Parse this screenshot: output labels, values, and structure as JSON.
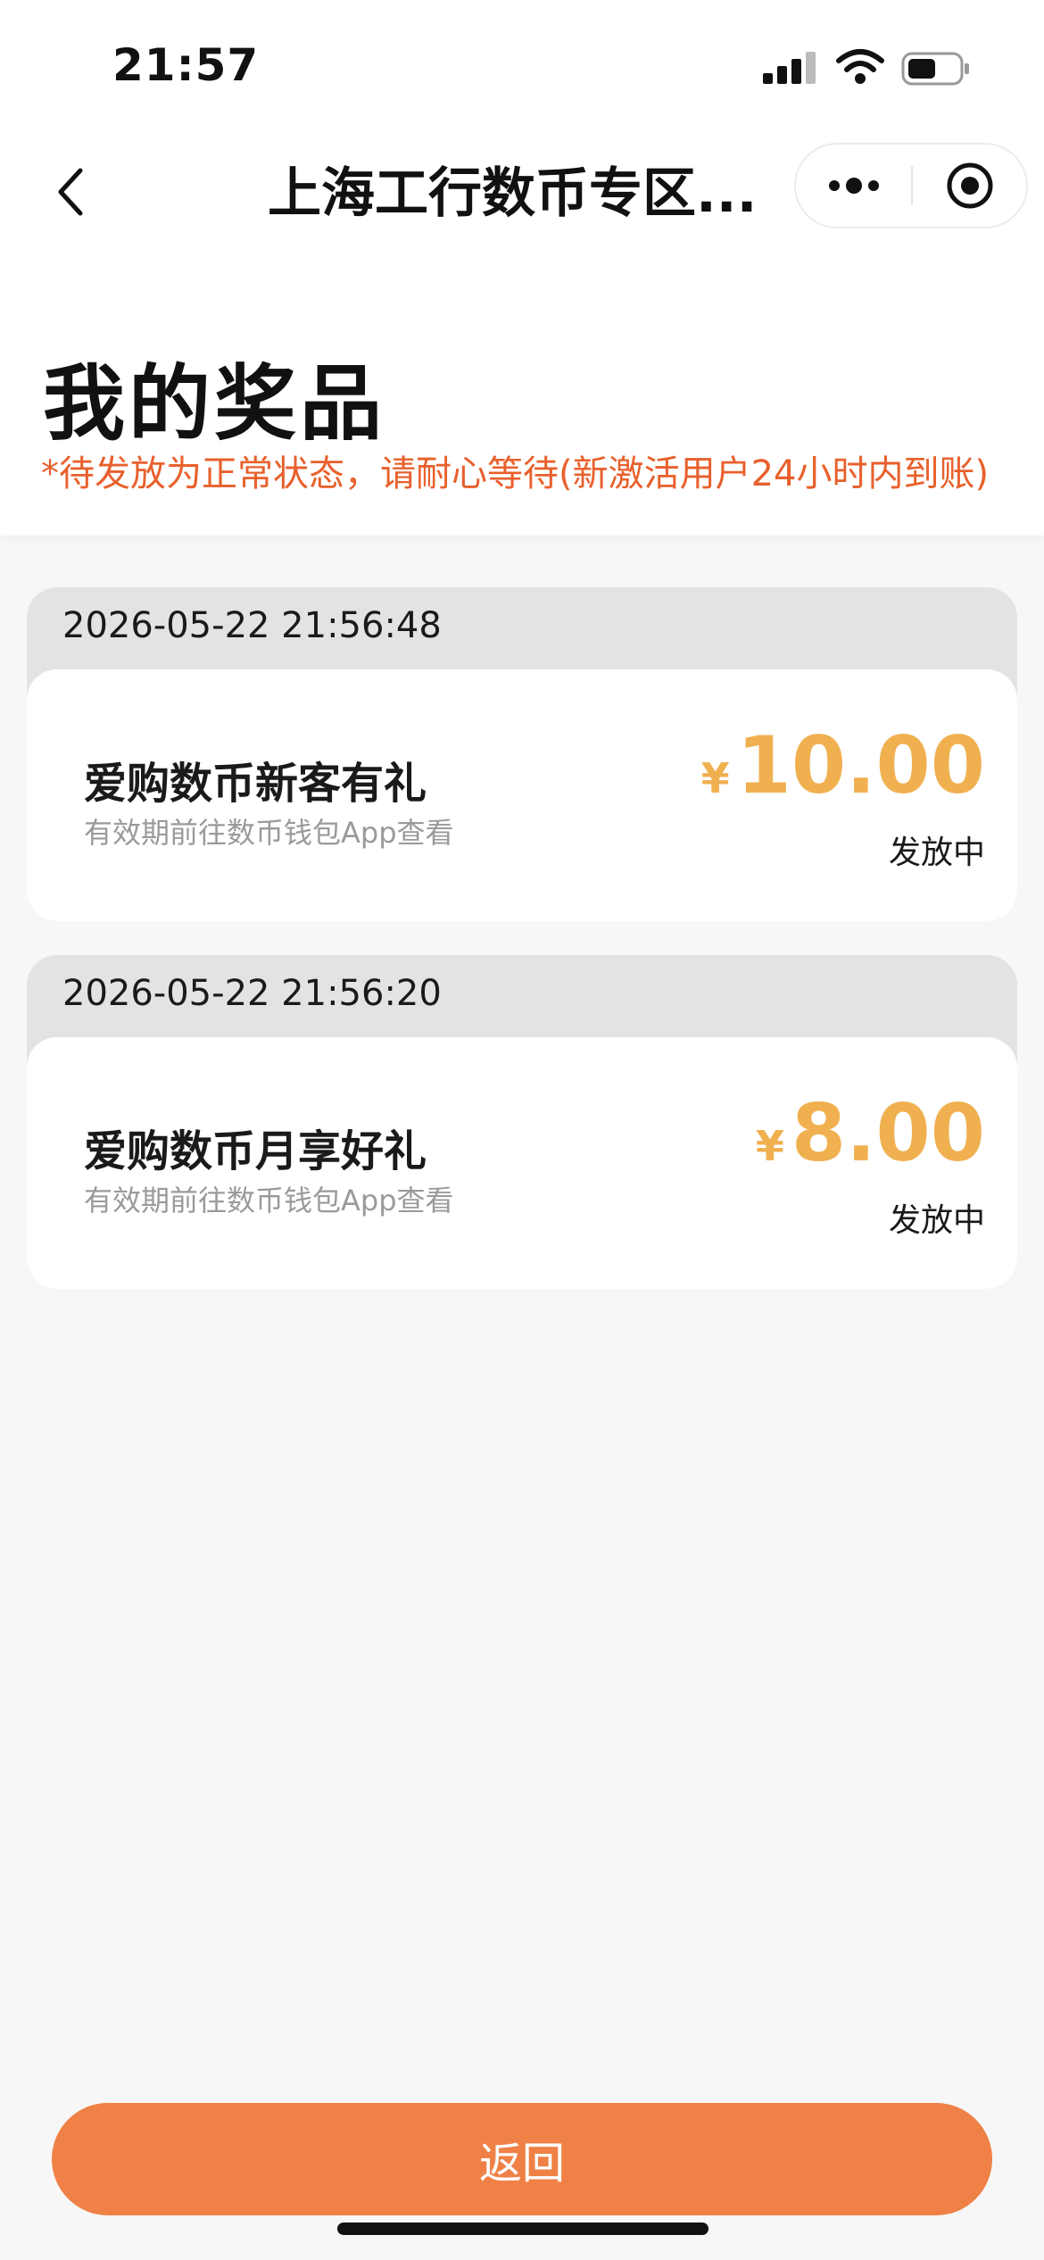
{
  "status_bar": {
    "time": "21:57"
  },
  "nav": {
    "title": "上海工行数币专区..."
  },
  "header": {
    "title": "我的奖品",
    "notice": "*待发放为正常状态，请耐心等待(新激活用户24小时内到账)"
  },
  "prizes": [
    {
      "date": "2026-05-22 21:56:48",
      "name": "爱购数币新客有礼",
      "subtitle": "有效期前往数币钱包App查看",
      "currency": "¥",
      "amount": "10.00",
      "status": "发放中"
    },
    {
      "date": "2026-05-22 21:56:20",
      "name": "爱购数币月享好礼",
      "subtitle": "有效期前往数币钱包App查看",
      "currency": "¥",
      "amount": "8.00",
      "status": "发放中"
    }
  ],
  "footer": {
    "return_label": "返回"
  },
  "colors": {
    "accent": "#ef8146",
    "amount": "#f0b050",
    "notice": "#e8602c"
  },
  "icons": {
    "back": "chevron-left-icon",
    "more": "more-dots-icon",
    "close": "target-circle-icon"
  }
}
